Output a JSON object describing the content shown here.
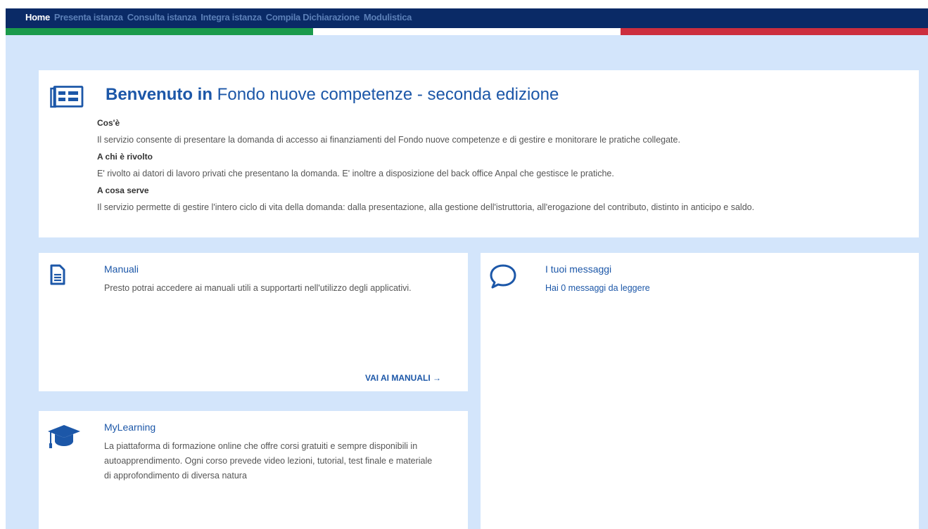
{
  "nav": {
    "items": [
      {
        "label": "Home",
        "active": true
      },
      {
        "label": "Presenta istanza",
        "active": false
      },
      {
        "label": "Consulta istanza",
        "active": false
      },
      {
        "label": "Integra istanza",
        "active": false
      },
      {
        "label": "Compila Dichiarazione",
        "active": false
      },
      {
        "label": "Modulistica",
        "active": false
      }
    ]
  },
  "colors": {
    "nav_bg": "#0a2a66",
    "flag_green": "#1b9a4b",
    "flag_white": "#ffffff",
    "flag_red": "#cc2e3e",
    "page_bg": "#d3e5fb",
    "accent_blue": "#1c57a8"
  },
  "welcome": {
    "icon": "newspaper-icon",
    "title_bold": "Benvenuto in",
    "title_rest": " Fondo nuove competenze - seconda edizione",
    "sections": [
      {
        "heading": "Cos'è",
        "text": "Il servizio consente di presentare la domanda di accesso ai finanziamenti del Fondo nuove competenze e di gestire e monitorare le pratiche collegate."
      },
      {
        "heading": "A chi è rivolto",
        "text": "E' rivolto ai datori di lavoro privati che presentano la domanda. E' inoltre a disposizione del back office Anpal che gestisce le pratiche."
      },
      {
        "heading": "A cosa serve",
        "text": "Il servizio permette di gestire l'intero ciclo di vita della domanda: dalla presentazione, alla gestione dell'istruttoria, all'erogazione del contributo, distinto in anticipo e saldo."
      }
    ]
  },
  "manuali": {
    "icon": "document-icon",
    "title": "Manuali",
    "text": "Presto potrai accedere ai manuali utili a supportarti nell'utilizzo degli applicativi.",
    "link": "VAI AI MANUALI →"
  },
  "messaggi": {
    "icon": "speech-bubble-icon",
    "title": "I tuoi messaggi",
    "text": "Hai 0 messaggi da leggere"
  },
  "mylearning": {
    "icon": "graduation-cap-icon",
    "title": "MyLearning",
    "text": "La piattaforma di formazione online che offre corsi gratuiti e sempre disponibili in autoapprendimento. Ogni corso prevede video lezioni, tutorial, test finale e materiale di approfondimento di diversa natura"
  }
}
